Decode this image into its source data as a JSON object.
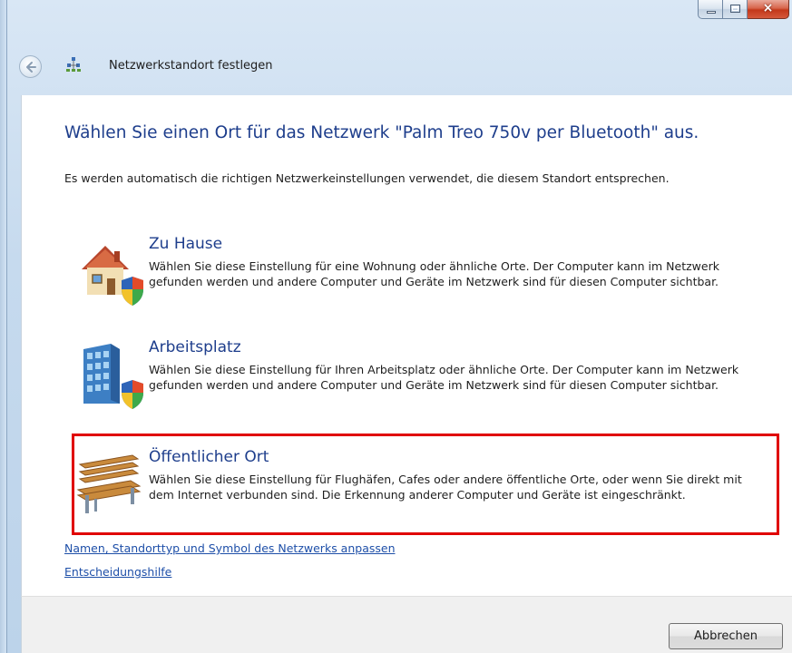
{
  "window": {
    "title": "Netzwerkstandort festlegen",
    "caption_buttons": {
      "minimize": "minimize-icon",
      "maximize": "maximize-icon",
      "close": "×"
    }
  },
  "main": {
    "heading": "Wählen Sie einen Ort für das Netzwerk \"Palm Treo 750v per Bluetooth\" aus.",
    "intro": "Es werden automatisch die richtigen Netzwerkeinstellungen verwendet, die diesem Standort entsprechen.",
    "options": [
      {
        "icon": "house-shield-icon",
        "title": "Zu Hause",
        "description": "Wählen Sie diese Einstellung für eine Wohnung oder ähnliche Orte. Der Computer kann im Netzwerk gefunden werden und andere Computer und Geräte im Netzwerk sind für diesen Computer sichtbar."
      },
      {
        "icon": "office-building-shield-icon",
        "title": "Arbeitsplatz",
        "description": "Wählen Sie diese Einstellung für Ihren Arbeitsplatz oder ähnliche Orte. Der Computer kann im Netzwerk gefunden werden und andere Computer und Geräte im Netzwerk sind für diesen Computer sichtbar."
      },
      {
        "icon": "park-bench-icon",
        "title": "Öffentlicher Ort",
        "description": "Wählen Sie diese Einstellung für Flughäfen, Cafes oder andere öffentliche Orte, oder wenn Sie direkt mit dem Internet verbunden sind. Die Erkennung anderer Computer und Geräte ist eingeschränkt."
      }
    ],
    "links": {
      "customize": "Namen, Standorttyp und Symbol des Netzwerks anpassen",
      "help": "Entscheidungshilfe"
    }
  },
  "footer": {
    "cancel_label": "Abbrechen"
  },
  "colors": {
    "heading": "#1e3e8c",
    "link": "#1e4fa8",
    "highlight_border": "#e00000"
  }
}
